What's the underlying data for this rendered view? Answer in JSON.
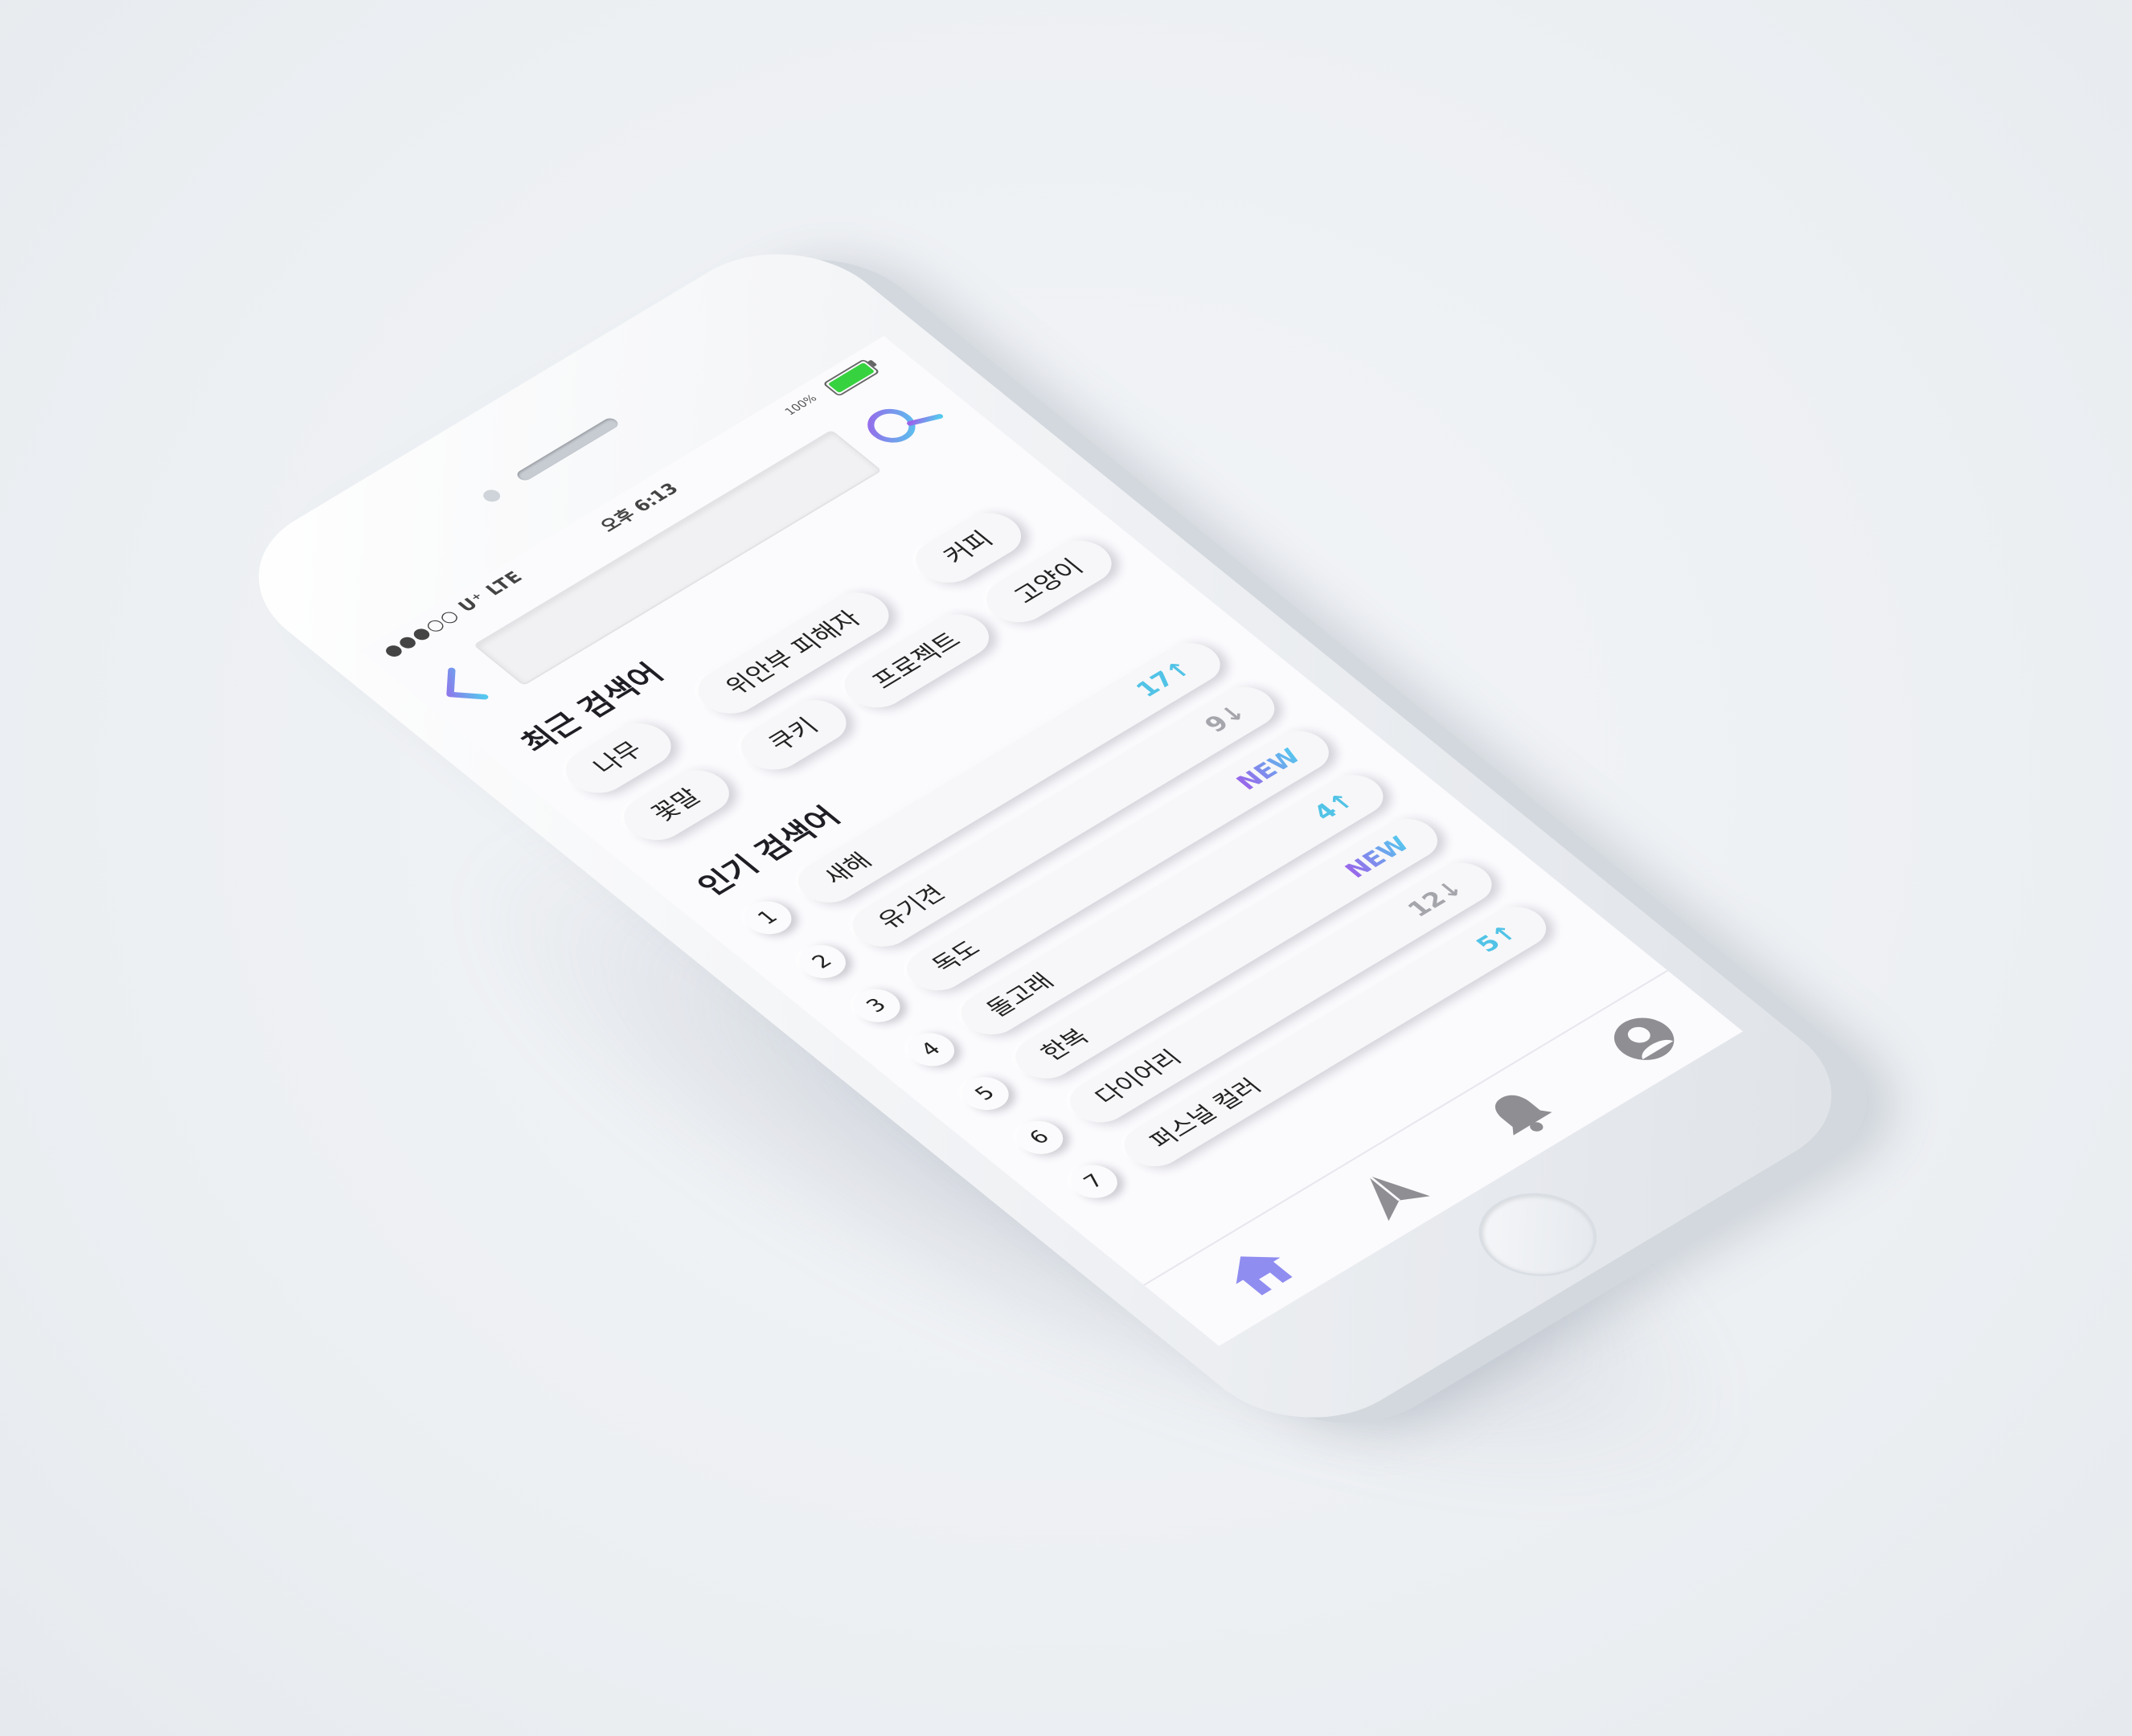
{
  "statusbar": {
    "carrier": "●●●○○ U⁺ LTE",
    "time": "오후 6:13",
    "battery_pct": "100%",
    "battery_level": 1.0,
    "battery_color": "#37d23f"
  },
  "header": {
    "back_icon": "chevron-left-icon",
    "search_value": "",
    "search_icon": "search-icon"
  },
  "recent": {
    "title": "최근 검색어",
    "chips": [
      "커피",
      "위안부 피해자",
      "고양이",
      "나무",
      "프로젝트",
      "쿠키",
      "꽃말"
    ]
  },
  "popular": {
    "title": "인기 검색어",
    "items": [
      {
        "rank": "1",
        "term": "새해",
        "change": "17↑",
        "kind": "up"
      },
      {
        "rank": "2",
        "term": "유기견",
        "change": "9↓",
        "kind": "down"
      },
      {
        "rank": "3",
        "term": "독도",
        "change": "NEW",
        "kind": "new"
      },
      {
        "rank": "4",
        "term": "돌고래",
        "change": "4↑",
        "kind": "up"
      },
      {
        "rank": "5",
        "term": "한복",
        "change": "NEW",
        "kind": "new"
      },
      {
        "rank": "6",
        "term": "다이어리",
        "change": "12↓",
        "kind": "down"
      },
      {
        "rank": "7",
        "term": "퍼스널 컬러",
        "change": "5↑",
        "kind": "up"
      }
    ]
  },
  "tabbar": {
    "tabs": [
      {
        "name": "home",
        "icon": "home-icon",
        "active": true
      },
      {
        "name": "send",
        "icon": "paper-plane-icon",
        "active": false
      },
      {
        "name": "notifications",
        "icon": "bell-icon",
        "active": false
      },
      {
        "name": "profile",
        "icon": "user-icon",
        "active": false
      }
    ]
  },
  "colors": {
    "accent_purple": "#9b63ea",
    "accent_cyan": "#55c8ee",
    "active_tab": "#8f8df0",
    "inactive_tab": "#8e8e93"
  }
}
